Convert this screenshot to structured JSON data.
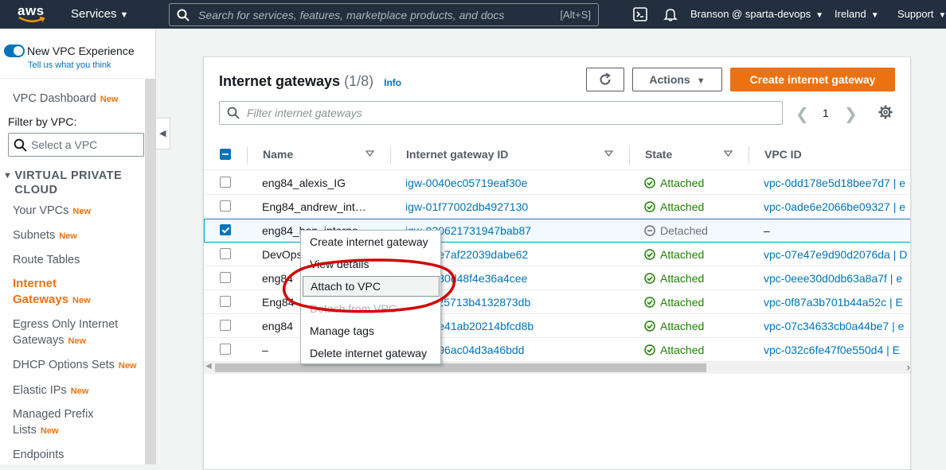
{
  "topnav": {
    "logo_text": "aws",
    "services_label": "Services",
    "search_placeholder": "Search for services, features, marketplace products, and docs",
    "search_shortcut": "[Alt+S]",
    "account_label": "Branson @ sparta-devops",
    "region_label": "Ireland",
    "support_label": "Support"
  },
  "sidebar": {
    "toggle_label": "New VPC Experience",
    "toggle_sublabel": "Tell us what you think",
    "dashboard_label": "VPC Dashboard",
    "new_badge": "New",
    "filter_label": "Filter by VPC:",
    "select_placeholder": "Select a VPC",
    "section_title": "VIRTUAL PRIVATE CLOUD",
    "items": [
      {
        "label": "Your VPCs",
        "new": "New"
      },
      {
        "label": "Subnets",
        "new": "New"
      },
      {
        "label": "Route Tables",
        "new": ""
      },
      {
        "label": "Internet Gateways",
        "new": "New"
      },
      {
        "label": "Egress Only Internet Gateways",
        "new": "New"
      },
      {
        "label": "DHCP Options Sets",
        "new": "New"
      },
      {
        "label": "Elastic IPs",
        "new": "New"
      },
      {
        "label": "Managed Prefix Lists",
        "new": "New"
      },
      {
        "label": "Endpoints",
        "new": ""
      }
    ]
  },
  "panel": {
    "title": "Internet gateways",
    "count": "(1/8)",
    "info_label": "Info",
    "actions_label": "Actions",
    "create_label": "Create internet gateway",
    "filter_placeholder": "Filter internet gateways",
    "page_number": "1"
  },
  "table": {
    "columns": [
      "Name",
      "Internet gateway ID",
      "State",
      "VPC ID"
    ],
    "rows": [
      {
        "name": "eng84_alexis_IG",
        "igw": "igw-0040ec05719eaf30e",
        "state": "Attached",
        "vpc": "vpc-0dd178e5d18bee7d7 | e",
        "checked": false
      },
      {
        "name": "Eng84_andrew_int…",
        "igw": "igw-01f77002db4927130",
        "state": "Attached",
        "vpc": "vpc-0ade6e2066be09327 | e",
        "checked": false
      },
      {
        "name": "eng84_ben_interne",
        "igw": "igw-030621731947bab87",
        "state": "Detached",
        "vpc": "–",
        "checked": true
      },
      {
        "name": "DevOps",
        "igw": "igw-0ae7af22039dabe62",
        "state": "Attached",
        "vpc": "vpc-07e47e9d90d2076da | D",
        "checked": false
      },
      {
        "name": "eng84",
        "igw": "igw-0a80d48f4e36a4cee",
        "state": "Attached",
        "vpc": "vpc-0eee30d0db63a8a7f | e",
        "checked": false
      },
      {
        "name": "Eng84",
        "igw": "igw-0c25713b4132873db",
        "state": "Attached",
        "vpc": "vpc-0f87a3b701b44a52c | E",
        "checked": false
      },
      {
        "name": "eng84",
        "igw": "igw-06e41ab20214bfcd8b",
        "state": "Attached",
        "vpc": "vpc-07c34633cb0a44be7 | e",
        "checked": false
      },
      {
        "name": "–",
        "igw": "igw-0b96ac04d3a46bdd",
        "state": "Attached",
        "vpc": "vpc-032c6fe47f0e550d4 | E",
        "checked": false
      }
    ]
  },
  "context_menu": {
    "items": [
      {
        "label": "Create internet gateway",
        "disabled": false
      },
      {
        "label": "View details",
        "disabled": false
      },
      {
        "label": "Attach to VPC",
        "disabled": false
      },
      {
        "label": "Detach from VPC",
        "disabled": true
      },
      {
        "label": "Manage tags",
        "disabled": false
      },
      {
        "label": "Delete internet gateway",
        "disabled": false
      }
    ]
  },
  "colors": {
    "nav_bg": "#232f3e",
    "accent_orange": "#ec7211",
    "link_blue": "#0073bb",
    "attached_green": "#1d8102",
    "annotation_red": "#d40000"
  },
  "icons": [
    "search-icon",
    "cloudshell-icon",
    "bell-icon",
    "refresh-icon",
    "settings-gear-icon",
    "check-circle-icon",
    "minus-circle-icon",
    "sort-caret-icon"
  ]
}
